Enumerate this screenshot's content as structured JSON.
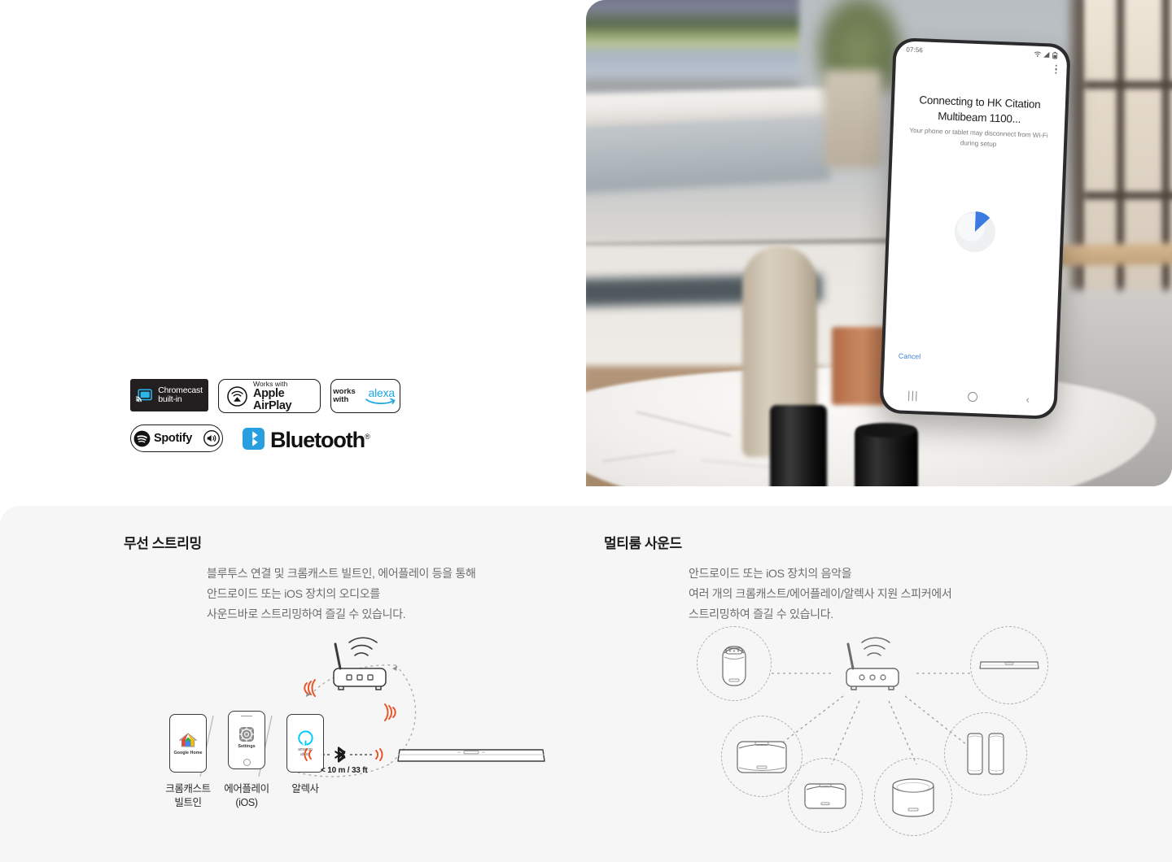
{
  "badges": {
    "chromecast": {
      "line1": "Chromecast",
      "line2": "built-in",
      "icon": "chromecast-icon"
    },
    "airplay": {
      "works": "Works with",
      "name": "Apple AirPlay",
      "icon": "airplay-icon"
    },
    "alexa": {
      "works_line1": "works",
      "works_line2": "with",
      "name": "alexa",
      "icon": "alexa-swoosh-icon"
    },
    "spotify": {
      "name": "Spotify",
      "icon": "spotify-icon",
      "speaker_icon": "speaker-icon"
    },
    "bluetooth": {
      "name": "Bluetooth",
      "registered": "®",
      "icon": "bluetooth-icon"
    }
  },
  "hero": {
    "phone": {
      "status_time": "07:56",
      "status_icons": [
        "wifi-icon",
        "signal-icon",
        "battery-icon"
      ],
      "menu_icon": "kebab-menu-icon",
      "title": "Connecting to HK Citation Multibeam 1100...",
      "subtitle": "Your phone or tablet may disconnect from Wi-Fi during setup",
      "cancel_label": "Cancel",
      "spinner_color": "#3b7ae0",
      "nav": {
        "recents": "|||",
        "home": "home-circle-icon",
        "back": "‹"
      }
    }
  },
  "sections": [
    {
      "id": "wireless-streaming",
      "title": "무선 스트리밍",
      "body_lines": [
        "블루투스 연결 및 크롬캐스트 빌트인, 에어플레이 등을 통해",
        "안드로이드 또는 iOS 장치의 오디오를",
        "사운드바로 스트리밍하여 즐길 수 있습니다."
      ]
    },
    {
      "id": "multiroom-sound",
      "title": "멀티룸 사운드",
      "body_lines": [
        "안드로이드 또는 iOS 장치의 음악을",
        "여러 개의 크롬캐스트/에어플레이/알렉사 지원 스피커에서",
        "스트리밍하여 즐길 수 있습니다."
      ]
    }
  ],
  "diagram_left": {
    "devices": [
      {
        "id": "chromecast-phone",
        "app_label": "Google Home",
        "caption_line1": "크롬캐스트",
        "caption_line2": "빌트인",
        "icon": "google-home-icon"
      },
      {
        "id": "airplay-phone",
        "app_label": "Settings",
        "caption_line1": "에어플레이",
        "caption_line2": "(iOS)",
        "icon": "ios-settings-icon"
      },
      {
        "id": "alexa-phone",
        "app_label1": "amazon",
        "app_label2": "alexa",
        "caption_line1": "알렉사",
        "caption_line2": "",
        "icon": "amazon-alexa-icon"
      }
    ],
    "router": {
      "icon": "wifi-router-icon"
    },
    "soundbar": {
      "icon": "soundbar-icon"
    },
    "bluetooth_range_label": "< 10 m / 33 ft",
    "bluetooth_icon": "bluetooth-icon",
    "signal_color": "#e8552a"
  },
  "diagram_right": {
    "router": {
      "icon": "wifi-router-icon"
    },
    "speakers": [
      {
        "id": "portable-speaker",
        "icon": "portable-speaker-icon"
      },
      {
        "id": "soundbar",
        "icon": "soundbar-icon"
      },
      {
        "id": "wide-speaker",
        "icon": "wide-speaker-icon"
      },
      {
        "id": "small-speaker",
        "icon": "small-speaker-icon"
      },
      {
        "id": "cylinder-speaker",
        "icon": "cylinder-speaker-icon"
      },
      {
        "id": "tower-speaker-pair",
        "icon": "tower-speaker-pair-icon"
      }
    ]
  }
}
